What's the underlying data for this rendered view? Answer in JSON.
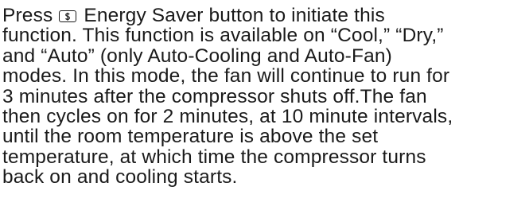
{
  "paragraph": {
    "line1_before": "Press",
    "button_icon": "dollar-sign-button-icon",
    "line1_after": "Energy Saver button to initiate this",
    "line2": "function. This function is available on “Cool,” “Dry,”",
    "line3": "and “Auto” (only Auto-Cooling and Auto-Fan)",
    "line4": "modes. In this mode, the fan will continue to run for",
    "line5": "3 minutes after the compressor shuts off.The fan",
    "line6": "then cycles on for 2 minutes, at 10 minute intervals,",
    "line7": "until the room temperature is above the set",
    "line8": "temperature, at which time the compressor turns",
    "line9": "back on and cooling starts."
  }
}
